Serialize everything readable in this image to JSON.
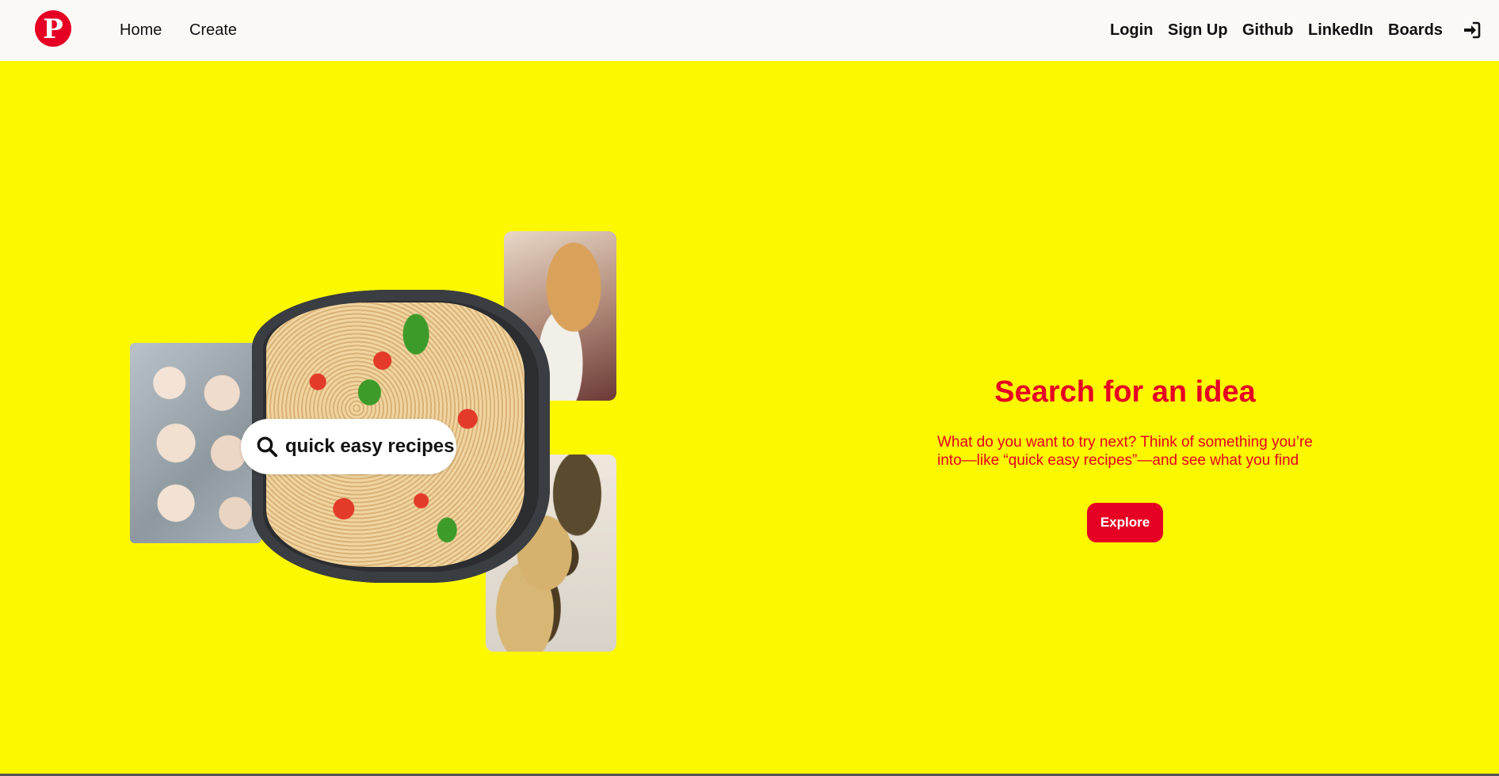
{
  "nav": {
    "logo_icon": "pinterest-logo",
    "logo_letter": "P",
    "left_links": [
      "Home",
      "Create"
    ],
    "right_links": [
      "Login",
      "Sign Up",
      "Github",
      "LinkedIn",
      "Boards"
    ],
    "login_icon": "sign-in-icon"
  },
  "hero": {
    "background": "#fbf800",
    "accent": "#e60023",
    "search_pill_text": "quick easy recipes",
    "title": "Search for an idea",
    "description": "What do you want to try next? Think of something you’re into—like “quick easy recipes”—and see what you find",
    "explore_label": "Explore"
  }
}
